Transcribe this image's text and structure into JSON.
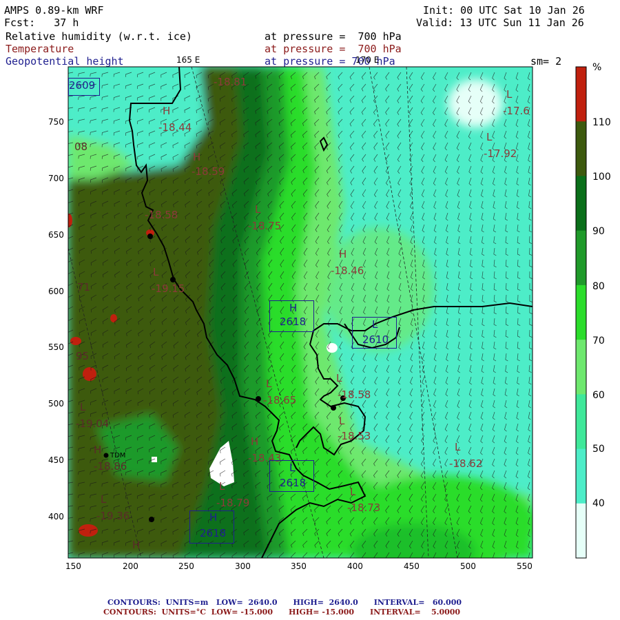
{
  "header": {
    "model": "AMPS 0.89-km WRF",
    "fcst": "Fcst:   37 h",
    "init": "Init: 00 UTC Sat 10 Jan 26",
    "valid": "Valid: 13 UTC Sun 11 Jan 26",
    "rh_label": "Relative humidity (w.r.t. ice)",
    "temp_label": "Temperature",
    "geo_label": "Geopotential height",
    "pressure_1": "at pressure =  700 hPa",
    "pressure_2": "at pressure =  700 hPa",
    "pressure_3": "at pressure = 700 hPa",
    "lon_165": "165 E",
    "lon_170": "170 E",
    "sm": "sm= 2"
  },
  "axes": {
    "x_ticks": [
      "150",
      "200",
      "250",
      "300",
      "350",
      "400",
      "450",
      "500",
      "550"
    ],
    "y_ticks": [
      "750",
      "700",
      "650",
      "600",
      "550",
      "500",
      "450",
      "400"
    ]
  },
  "colorbar": {
    "unit": "%",
    "labels": [
      "110",
      "100",
      "90",
      "80",
      "70",
      "60",
      "50",
      "40"
    ],
    "colors": [
      "#c0200e",
      "#3d5a0e",
      "#0a6f1a",
      "#1f9a2a",
      "#2bdd2b",
      "#6ee86e",
      "#3fe89a",
      "#4dedc8",
      "#e6fff8"
    ]
  },
  "map_labels": {
    "t1": "-18.44",
    "t2": "-18.59",
    "t3": "-18.81",
    "t4": "-18.75",
    "t5": "-18.58",
    "t6": "-19.15",
    "t7": "-18.46",
    "t8": "-17.92",
    "t9": "-17.6",
    "t10": "-18.65",
    "t11": "-18.58",
    "t12": "-18.53",
    "t13": "-18.43",
    "t14": "-18.62",
    "t15": "-18.79",
    "t16": "-18.73",
    "t17": "-19.04",
    "t18": "-18.86",
    "t19": "-19.36",
    "h1": "2618",
    "h2": "2610",
    "h3": "2618",
    "h4": "2618",
    "h5": "2609",
    "n1": "08",
    "n2": "95",
    "n3": "71",
    "station": "TDM",
    "H": "H",
    "L": "L"
  },
  "footer": {
    "line1": "CONTOURS:  UNITS=m   LOW=  2640.0      HIGH=  2640.0      INTERVAL=   60.000",
    "line2": "CONTOURS:  UNITS=°C  LOW= -15.000      HIGH= -15.000      INTERVAL=    5.0000"
  }
}
